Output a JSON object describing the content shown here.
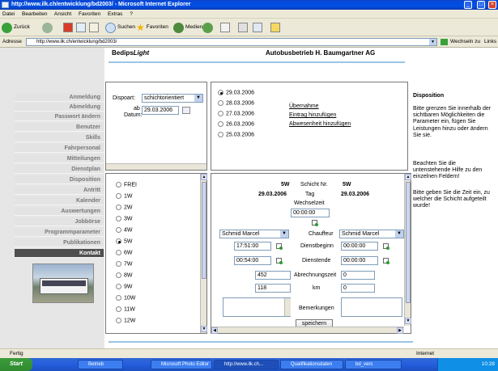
{
  "window": {
    "title": "http://www.ilk.ch/entwicklung/bd2003/ - Microsoft Internet Explorer"
  },
  "menu": [
    "Datei",
    "Bearbeiten",
    "Ansicht",
    "Favoriten",
    "Extras",
    "?"
  ],
  "toolbar": {
    "back": "Zurück",
    "search": "Suchen",
    "favorites": "Favoriten",
    "media": "Medien"
  },
  "address": {
    "label": "Adresse",
    "url": "http://www.ilk.ch/entwicklung/bd2003/",
    "go": "Wechseln zu",
    "links": "Links"
  },
  "header": {
    "logo_prefix": "Bedips",
    "logo_suffix": "Light",
    "company": "Autobusbetrieb H. Baumgartner AG"
  },
  "nav": {
    "items": [
      "Anmeldung",
      "Abmeldung",
      "Passwort ändern",
      "Benutzer",
      "Skills",
      "Fahrpersonal",
      "Mitteilungen",
      "Dienstplan",
      "Disposition",
      "Antritt",
      "Kalender",
      "Auswertungen",
      "Jobbörse",
      "Programmparameter",
      "Publikationen",
      "Kontakt"
    ],
    "active_index": 15
  },
  "dispo": {
    "label": "Dispoart:",
    "value": "schichtorientiert",
    "date_label_1": "ab",
    "date_label_2": "Datum:",
    "date_value": "29.03.2006"
  },
  "dates": {
    "items": [
      "29.03.2006",
      "28.03.2006",
      "27.03.2006",
      "26.03.2006",
      "25.03.2006"
    ],
    "selected": 0
  },
  "actions": [
    "Übernahme",
    "Eintrag hinzufügen",
    "Abwesenheit hinzufügen"
  ],
  "shifts": {
    "items": [
      "FREI",
      "1W",
      "2W",
      "3W",
      "4W",
      "5W",
      "6W",
      "7W",
      "8W",
      "9W",
      "10W",
      "11W",
      "12W"
    ],
    "selected": 5
  },
  "detail": {
    "left_shift": "5W",
    "schicht_label": "Schicht Nr.",
    "right_shift": "5W",
    "left_date": "29.03.2006",
    "tag_label": "Tag",
    "right_date": "29.03.2006",
    "wechselzeit_label": "Wechselzeit",
    "wechselzeit": "00:00:00",
    "chauffeur_label": "Chauffeur",
    "chauffeur_left": "Schmid Marcel",
    "chauffeur_right": "Schmid Marcel",
    "dienstbeginn_label": "Dienstbeginn",
    "dienstbeginn_left": "17:51:00",
    "dienstbeginn_right": "00:00:00",
    "dienstende_label": "Dienstende",
    "dienstende_left": "00:54:00",
    "dienstende_right": "00:00:00",
    "abrechnungszeit_label": "Abrechnungszeit",
    "abrechnungszeit_left": "452",
    "abrechnungszeit_right": "0",
    "km_label": "km",
    "km_left": "118",
    "km_right": "0",
    "bemerkungen_label": "Bemerkungen",
    "save": "speichern"
  },
  "help": {
    "title": "Disposition",
    "p1": "Bitte grenzen Sie innerhalb der sichtbaren Möglichkeiten die Parameter ein, fügen Sie Leistungen hinzu oder ändern Sie sie.",
    "p2": "Beachten Sie die untenstehende Hilfe zu den einzelnen Feldern!",
    "p3": "Bitte geben Sie die Zeit ein, zu welcher die Schicht aufgeteilt wurde!"
  },
  "status": {
    "left": "Fertig",
    "zone": "Internet"
  },
  "taskbar": {
    "start": "Start",
    "tasks": [
      "Betrieb",
      "Microsoft Photo Editor",
      "http://www.ilk.ch...",
      "Qualifikationsdaten",
      "bd_vers"
    ],
    "active_task": 2,
    "clock": "10:28"
  }
}
